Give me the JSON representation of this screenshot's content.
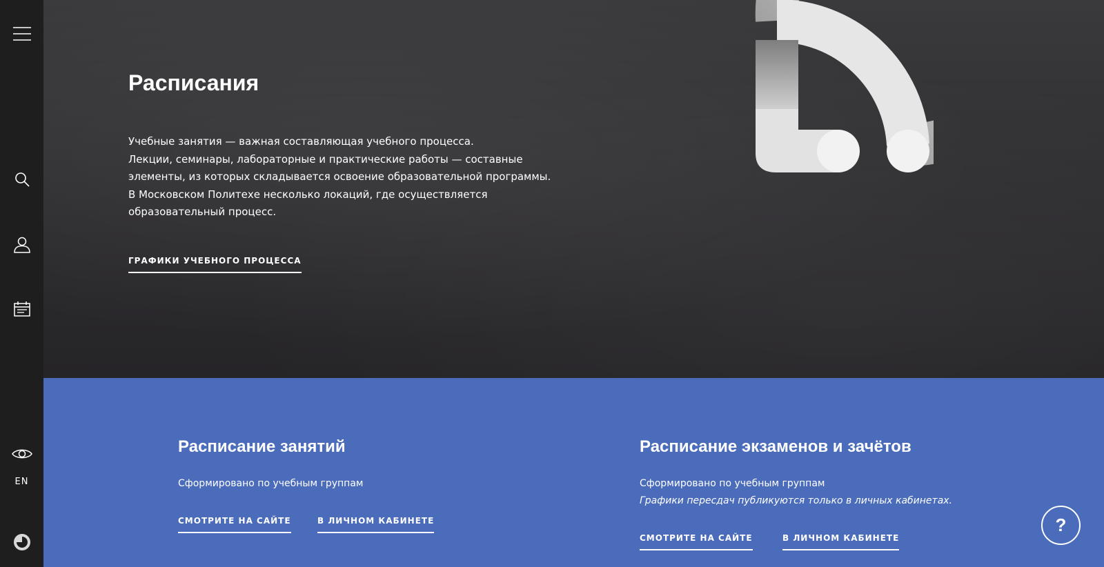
{
  "sidebar": {
    "lang_label": "EN",
    "icons": [
      "menu-icon",
      "search-icon",
      "user-icon",
      "calendar-icon",
      "eye-icon",
      "logo-icon"
    ]
  },
  "hero": {
    "title": "Расписания",
    "description": [
      "Учебные занятия — важная составляющая учебного процесса.",
      "Лекции, семинары, лабораторные и практические работы — составные элементы, из которых складывается освоение образовательной программы.",
      "В Московском Политехе несколько локаций, где осуществляется образовательный процесс."
    ],
    "link_label": "ГРАФИКИ УЧЕБНОГО ПРОЦЕССА",
    "illustration": "clock-icon"
  },
  "sections": [
    {
      "title": "Расписание занятий",
      "text": "Сформировано по учебным группам",
      "note": "",
      "site_link": "СМОТРИТЕ НА САЙТЕ",
      "cabinet_link": "В ЛИЧНОМ КАБИНЕТЕ"
    },
    {
      "title": "Расписание экзаменов и зачётов",
      "text": "Сформировано по учебным группам",
      "note": "Графики пересдач публикуются только в личных кабинетах.",
      "site_link": "СМОТРИТЕ НА САЙТЕ",
      "cabinet_link": "В ЛИЧНОМ КАБИНЕТЕ"
    }
  ],
  "help_label": "?",
  "colors": {
    "sidebar": "#1e1e1e",
    "hero_bg": "#2e2d30",
    "accent_blue": "#4a6cba",
    "text": "#ffffff"
  }
}
